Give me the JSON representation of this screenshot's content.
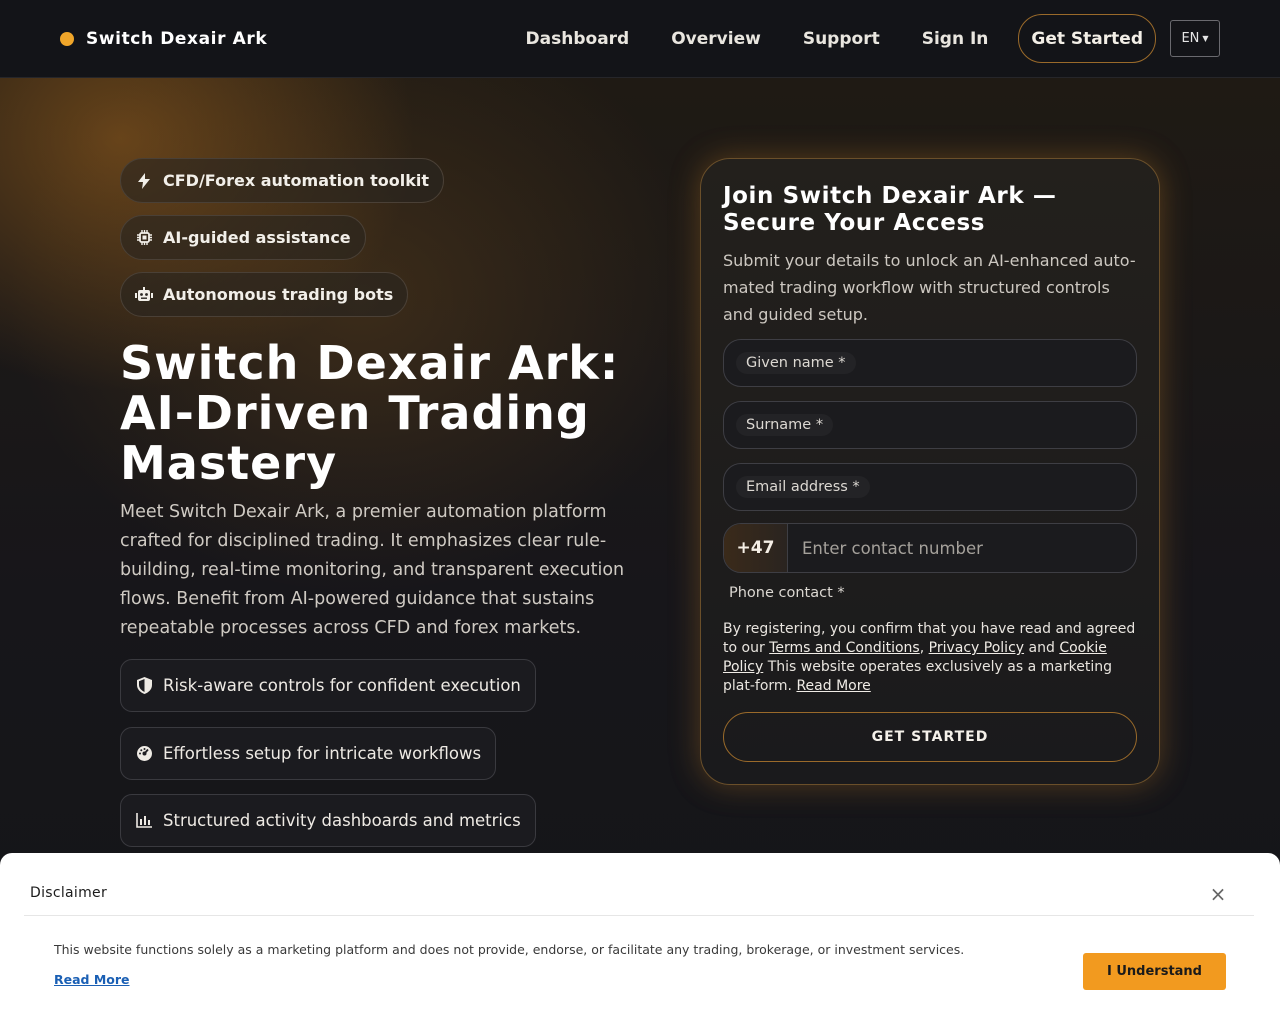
{
  "header": {
    "brand": "Switch Dexair Ark",
    "nav": [
      "Dashboard",
      "Overview",
      "Support",
      "Sign In"
    ],
    "cta": "Get Started",
    "language": "EN"
  },
  "hero": {
    "chips": [
      {
        "icon": "bolt-icon",
        "label": "CFD/Forex automation toolkit"
      },
      {
        "icon": "chip-icon",
        "label": "AI-guided assistance"
      },
      {
        "icon": "robot-icon",
        "label": "Autonomous trading bots"
      }
    ],
    "title": "Switch Dexair Ark: AI-Driven Trading Mastery",
    "description": "Meet Switch Dexair Ark, a premier automation platform crafted for disciplined trading. It emphasizes clear rule-building, real-time monitoring, and transparent execution flows. Benefit from AI-powered guidance that sustains repeatable processes across CFD and forex markets.",
    "features": [
      {
        "icon": "shield-icon",
        "label": "Risk-aware controls for confident execution"
      },
      {
        "icon": "gauge-icon",
        "label": "Effortless setup for intricate workflows"
      },
      {
        "icon": "bar-chart-icon",
        "label": "Structured activity dashboards and metrics"
      }
    ]
  },
  "form": {
    "title": "Join Switch Dexair Ark — Secure Your Access",
    "description": "Submit your details to unlock an AI-enhanced auto-mated trading workflow with structured controls and guided setup.",
    "given_name_label": "Given name *",
    "surname_label": "Surname *",
    "email_label": "Email address *",
    "phone_code": "+47",
    "phone_placeholder": "Enter contact number",
    "phone_label": "Phone contact *",
    "consent_prefix": "By registering, you confirm that you have read and agreed to our ",
    "terms_link": "Terms and Conditions",
    "comma": ", ",
    "privacy_link": "Privacy Policy",
    "and": " and ",
    "cookie_link": "Cookie Policy",
    "consent_suffix": " This website operates exclusively as a marketing plat-form. ",
    "read_more": "Read More",
    "submit": "GET STARTED"
  },
  "disclaimer": {
    "title": "Disclaimer",
    "close": "×",
    "text": "This website functions solely as a marketing platform and does not provide, endorse, or facilitate any trading, brokerage, or investment services.",
    "read_more": "Read More",
    "button": "I Understand"
  },
  "colors": {
    "accent": "#f29a1f",
    "brand_dot": "#f0a62a",
    "link": "#1a5fb4"
  }
}
